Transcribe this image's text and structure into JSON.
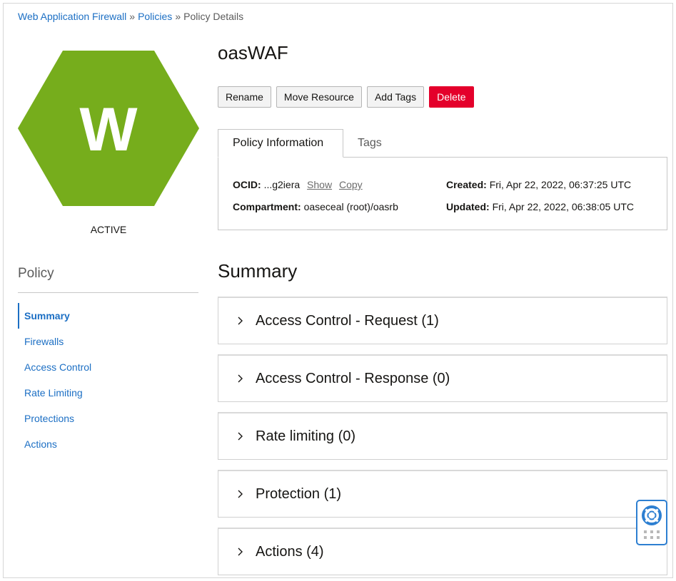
{
  "breadcrumb": {
    "items": [
      "Web Application Firewall",
      "Policies"
    ],
    "separator": "»",
    "current": "Policy Details"
  },
  "resource": {
    "icon_letter": "W",
    "status": "ACTIVE",
    "hex_color": "#76ad1c"
  },
  "sidebar": {
    "title": "Policy",
    "items": [
      {
        "label": "Summary"
      },
      {
        "label": "Firewalls"
      },
      {
        "label": "Access Control"
      },
      {
        "label": "Rate Limiting"
      },
      {
        "label": "Protections"
      },
      {
        "label": "Actions"
      }
    ]
  },
  "page": {
    "title": "oasWAF"
  },
  "actions": {
    "rename": "Rename",
    "move_resource": "Move Resource",
    "add_tags": "Add Tags",
    "delete": "Delete"
  },
  "tabs": {
    "policy_information": "Policy Information",
    "tags": "Tags"
  },
  "info": {
    "ocid_label": "OCID:",
    "ocid_value": "...g2iera",
    "show_link": "Show",
    "copy_link": "Copy",
    "compartment_label": "Compartment:",
    "compartment_value": "oaseceal (root)/oasrb",
    "created_label": "Created:",
    "created_value": "Fri, Apr 22, 2022, 06:37:25 UTC",
    "updated_label": "Updated:",
    "updated_value": "Fri, Apr 22, 2022, 06:38:05 UTC"
  },
  "summary": {
    "title": "Summary",
    "sections": [
      {
        "label": "Access Control - Request (1)"
      },
      {
        "label": "Access Control - Response (0)"
      },
      {
        "label": "Rate limiting (0)"
      },
      {
        "label": "Protection (1)"
      },
      {
        "label": "Actions (4)"
      }
    ]
  },
  "colors": {
    "link": "#1c6fc4",
    "danger": "#e4002b",
    "help_accent": "#2d7fd1"
  }
}
